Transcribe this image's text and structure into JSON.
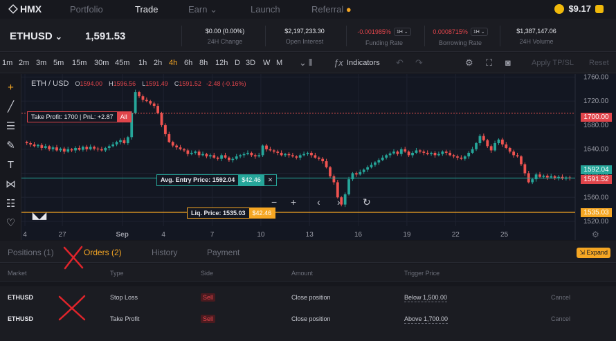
{
  "nav": {
    "logo": "HMX",
    "items": [
      "Portfolio",
      "Trade",
      "Earn",
      "Launch",
      "Referral"
    ],
    "active": "Trade",
    "earn_chevron": "chevron-down-icon",
    "balance": "$9.17"
  },
  "ticker": {
    "pair": "ETHUSD",
    "price": "1,591.53",
    "stats": [
      {
        "value": "$0.00 (0.00%)",
        "label": "24H Change"
      },
      {
        "value": "$2,197,233.30",
        "label": "Open Interest"
      },
      {
        "value": "-0.001985%",
        "label": "Funding Rate",
        "interval": "1H"
      },
      {
        "value": "0.0008715%",
        "label": "Borrowing Rate",
        "interval": "1H"
      },
      {
        "value": "$1,387,147.06",
        "label": "24H Volume"
      }
    ]
  },
  "toolbar": {
    "timeframes": [
      "1m",
      "2m",
      "3m",
      "5m",
      "15m",
      "30m",
      "45m",
      "1h",
      "2h",
      "4h",
      "6h",
      "8h",
      "12h",
      "D",
      "3D",
      "W",
      "M"
    ],
    "active_timeframe": "4h",
    "indicators": "Indicators",
    "apply_tpsl": "Apply TP/SL",
    "reset": "Reset"
  },
  "chart": {
    "symbol": "ETH / USD",
    "o": "1594.00",
    "h": "1596.56",
    "l": "1591.49",
    "c": "1591.52",
    "change": "-2.48 (-0.16%)",
    "take_profit_label": "Take Profit: 1700",
    "pnl_label": "PnL: +2.87",
    "all_label": "All",
    "entry_label": "Avg. Entry Price: 1592.04",
    "entry_amount": "$42.46",
    "liq_label": "Liq. Price: 1535.03",
    "liq_amount": "$42.46",
    "price_tags": {
      "take_profit": "1700.00",
      "entry": "1592.04",
      "last": "1591.52",
      "liq": "1535.03"
    },
    "colors": {
      "up": "#26a69a",
      "down": "#ef5350",
      "liq": "#f5a623",
      "entry": "#2ecc71",
      "bg": "#131722"
    }
  },
  "chart_data": {
    "type": "candlestick",
    "title": "ETH / USD",
    "ylim": [
      1512,
      1765
    ],
    "y_ticks": [
      1760,
      1720,
      1680,
      1640,
      1600,
      1560,
      1520
    ],
    "x_ticks": [
      "4",
      "27",
      "Sep",
      "4",
      "7",
      "10",
      "13",
      "16",
      "19",
      "22",
      "25"
    ],
    "close_series": [
      1650,
      1648,
      1645,
      1647,
      1642,
      1645,
      1640,
      1643,
      1638,
      1641,
      1636,
      1640,
      1638,
      1642,
      1639,
      1644,
      1640,
      1644,
      1641,
      1640,
      1638,
      1642,
      1645,
      1648,
      1652,
      1655,
      1650,
      1660,
      1700,
      1735,
      1728,
      1722,
      1720,
      1716,
      1712,
      1700,
      1680,
      1665,
      1652,
      1646,
      1643,
      1640,
      1638,
      1632,
      1634,
      1636,
      1630,
      1632,
      1628,
      1630,
      1626,
      1624,
      1630,
      1626,
      1622,
      1624,
      1628,
      1630,
      1632,
      1634,
      1630,
      1628,
      1630,
      1646,
      1640,
      1638,
      1636,
      1634,
      1630,
      1632,
      1630,
      1628,
      1626,
      1630,
      1632,
      1634,
      1630,
      1626,
      1624,
      1620,
      1610,
      1595,
      1585,
      1560,
      1548,
      1565,
      1590,
      1600,
      1598,
      1602,
      1606,
      1610,
      1614,
      1618,
      1622,
      1626,
      1630,
      1633,
      1636,
      1632,
      1640,
      1636,
      1630,
      1634,
      1638,
      1636,
      1634,
      1632,
      1634,
      1630,
      1632,
      1636,
      1634,
      1630,
      1628,
      1626,
      1624,
      1628,
      1634,
      1640,
      1650,
      1662,
      1655,
      1645,
      1638,
      1650,
      1656,
      1648,
      1642,
      1636,
      1630,
      1628,
      1615,
      1600,
      1585,
      1590,
      1598,
      1594,
      1596,
      1593,
      1595,
      1592,
      1594,
      1591,
      1593,
      1592
    ],
    "levels": [
      {
        "name": "Take Profit",
        "value": 1700
      },
      {
        "name": "Avg. Entry Price",
        "value": 1592.04
      },
      {
        "name": "Liq. Price",
        "value": 1535.03
      }
    ]
  },
  "tabs": {
    "items": [
      "Positions (1)",
      "Orders (2)",
      "History",
      "Payment"
    ],
    "active": "Orders (2)",
    "expand": "Expand"
  },
  "table": {
    "headers": [
      "Market",
      "Type",
      "Side",
      "Amount",
      "Trigger Price"
    ],
    "rows": [
      {
        "market": "ETHUSD",
        "type": "Stop Loss",
        "side": "Sell",
        "amount": "Close position",
        "trigger": "Below 1,500.00",
        "action": "Cancel"
      },
      {
        "market": "ETHUSD",
        "type": "Take Profit",
        "side": "Sell",
        "amount": "Close position",
        "trigger": "Above 1,700.00",
        "action": "Cancel"
      }
    ]
  },
  "annotations": {
    "color": "#e0242b"
  }
}
